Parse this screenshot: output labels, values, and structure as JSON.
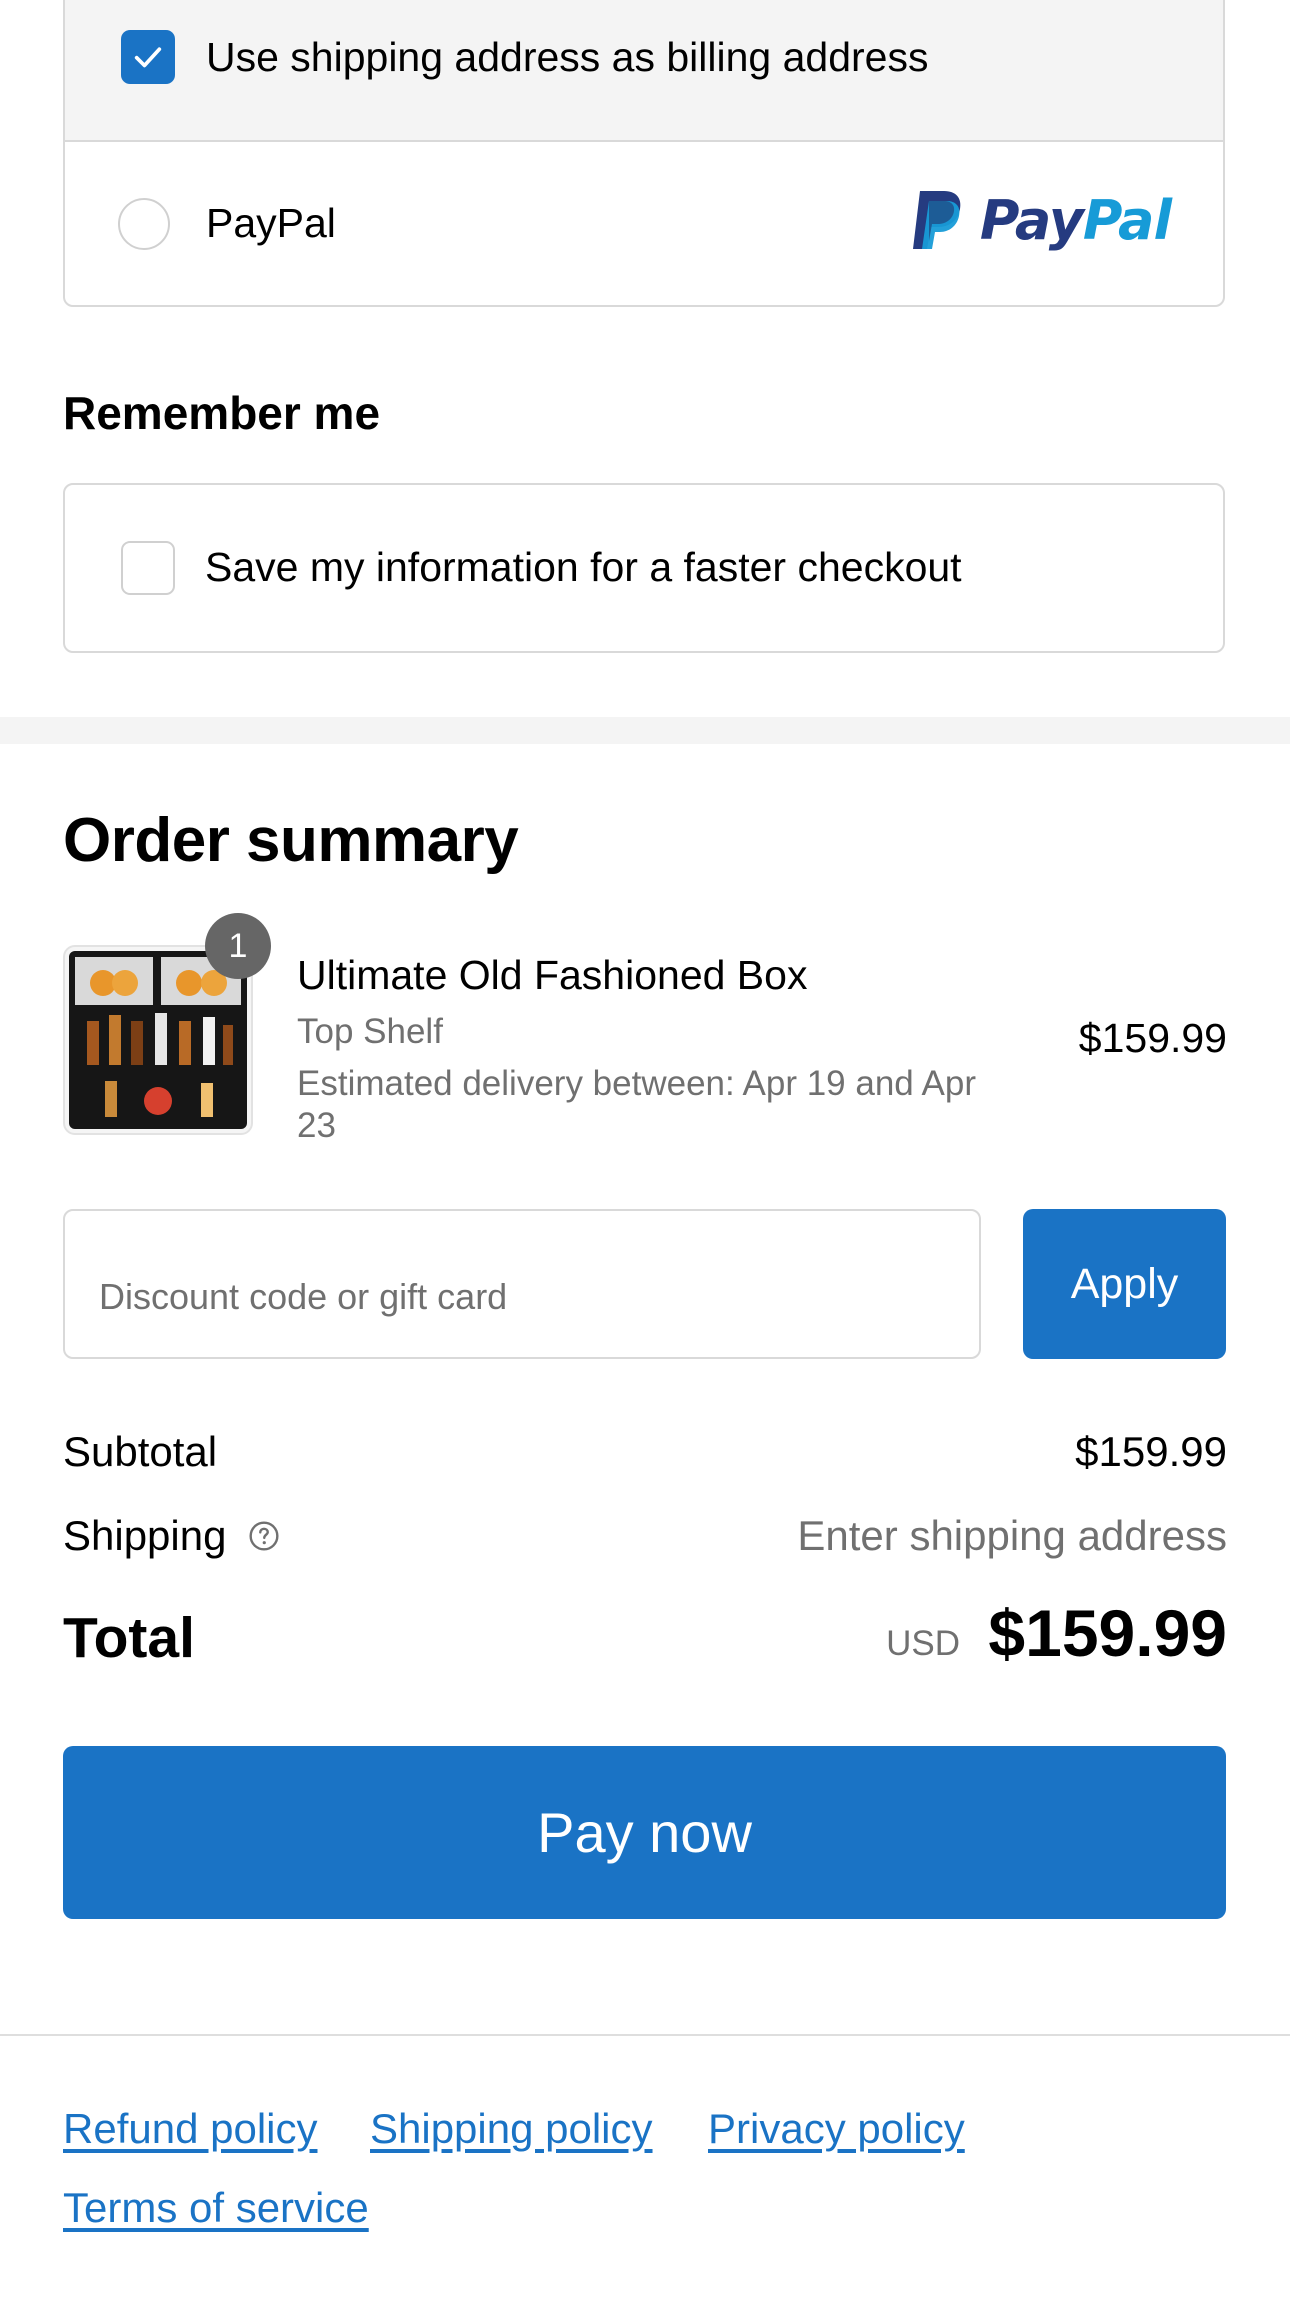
{
  "payment": {
    "billing_checkbox_label": "Use shipping address as billing address",
    "billing_checked": true,
    "paypal_option_label": "PayPal",
    "paypal_logo_text": [
      "Pay",
      "Pal"
    ]
  },
  "remember": {
    "title": "Remember me",
    "checkbox_label": "Save my information for a faster checkout",
    "checked": false
  },
  "order_summary": {
    "title": "Order summary",
    "item": {
      "quantity": "1",
      "name": "Ultimate Old Fashioned Box",
      "variant": "Top Shelf",
      "delivery": "Estimated delivery between: Apr 19 and Apr 23",
      "price": "$159.99"
    },
    "discount": {
      "placeholder": "Discount code or gift card",
      "apply_label": "Apply"
    },
    "subtotal_label": "Subtotal",
    "subtotal_value": "$159.99",
    "shipping_label": "Shipping",
    "shipping_value": "Enter shipping address",
    "total_label": "Total",
    "total_currency": "USD",
    "total_value": "$159.99"
  },
  "pay_button_label": "Pay now",
  "footer": {
    "links": [
      "Refund policy",
      "Shipping policy",
      "Privacy policy",
      "Terms of service"
    ]
  },
  "colors": {
    "accent": "#1a73c5",
    "muted_text": "#707070",
    "border": "#d9d9d9",
    "paypal_dark": "#253b80",
    "paypal_light": "#179bd7"
  }
}
